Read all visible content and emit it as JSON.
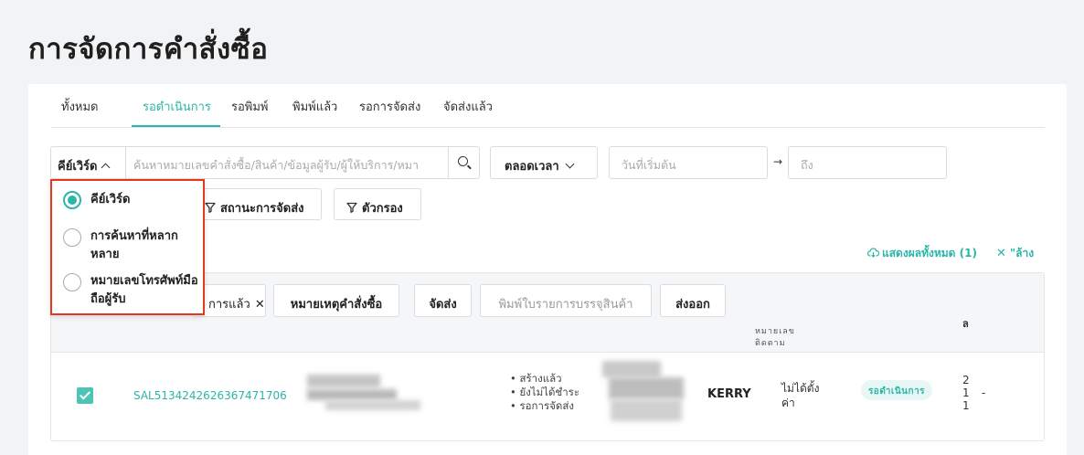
{
  "page_title": "การจัดการคำสั่งซื้อ",
  "tabs": [
    "ทั้งหมด",
    "รอดำเนินการ",
    "รอพิมพ์",
    "พิมพ์แล้ว",
    "รอการจัดส่ง",
    "จัดส่งแล้ว"
  ],
  "active_tab": "รอดำเนินการ",
  "search": {
    "keyword_button": "คีย์เวิร์ด",
    "placeholder": "ค้นหาหมายเลขคำสั่งซื้อ/สินค้า/ข้อมูลผู้รับ/ผู้ให้บริการ/หมา",
    "time_button": "ตลอดเวลา",
    "start_date_placeholder": "วันที่เริ่มต้น",
    "arrow": "→",
    "end_date_placeholder": "ถึง"
  },
  "filters": {
    "shipping_status": "สถานะการจัดส่ง",
    "filter": "ตัวกรอง"
  },
  "results": {
    "show_all": "แสดงผลทั้งหมด (1)",
    "clear": "\"ล้าง"
  },
  "bulk_actions": {
    "chip_label": "การแล้ว",
    "order_note": "หมายเหตุคำสั่งซื้อ",
    "ship": "จัดส่ง",
    "print_packing": "พิมพ์ใบรายการบรรจุสินค้า",
    "export": "ส่งออก"
  },
  "table_headers": {
    "tracking_line1": "หมายเลข",
    "tracking_line2": "ติดตาม",
    "last_col": "ล"
  },
  "row": {
    "order_id": "SAL5134242626367471706",
    "statuses": [
      "สร้างแล้ว",
      "ยังไม่ได้ชำระ",
      "รอการจัดส่ง"
    ],
    "courier": "KERRY",
    "tracking_line1": "ไม่ได้ตั้ง",
    "tracking_line2": "ค่า",
    "state": "รอดำเนินการ",
    "last_values": [
      "2",
      "1",
      "1"
    ],
    "dash": "-"
  },
  "dropdown_options": [
    {
      "label": "คีย์เวิร์ด",
      "selected": true
    },
    {
      "label": "การค้นหาที่หลากหลาย",
      "selected": false
    },
    {
      "label": "หมายเลขโทรศัพท์มือถือผู้รับ",
      "selected": false
    }
  ],
  "colors": {
    "accent": "#2bb5a8",
    "highlight_border": "#e4381e"
  }
}
